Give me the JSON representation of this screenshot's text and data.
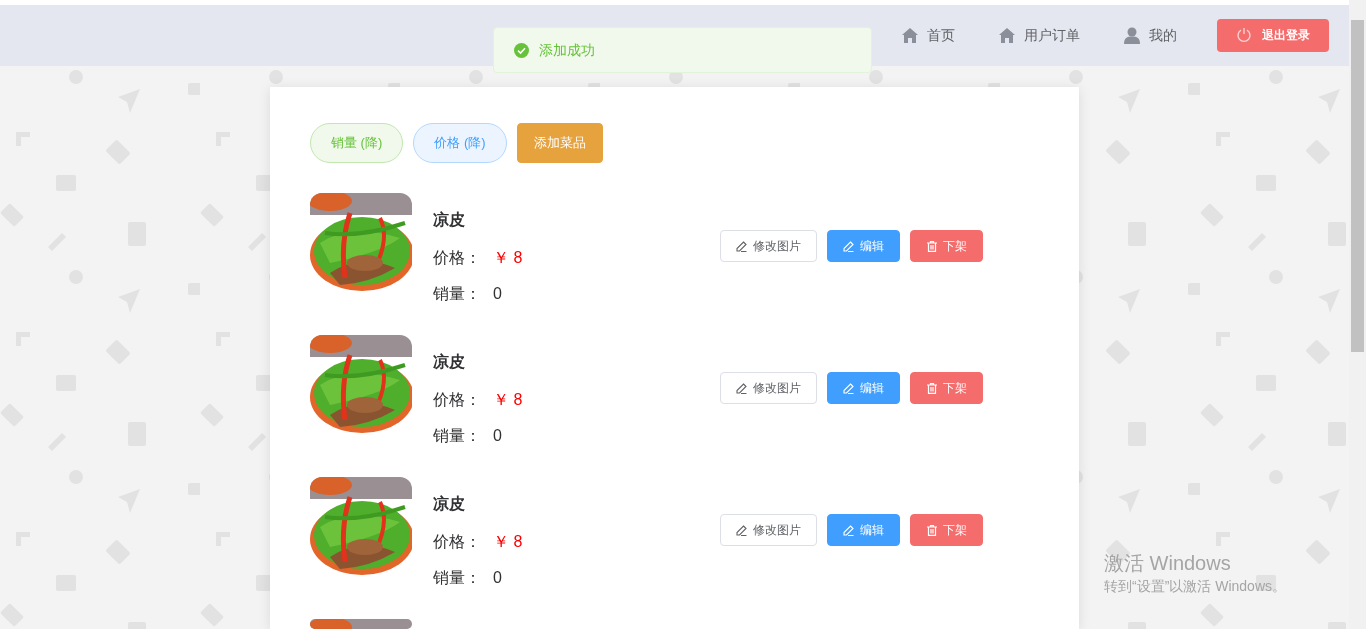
{
  "nav": {
    "items": [
      {
        "label": "首页",
        "kind": "home"
      },
      {
        "label": "用户订单",
        "kind": "home"
      },
      {
        "label": "我的",
        "kind": "user"
      }
    ],
    "logout": "退出登录"
  },
  "toast": {
    "kind": "success",
    "text": "添加成功"
  },
  "toolbar": [
    {
      "label": "销量 (降)",
      "kind": "success"
    },
    {
      "label": "价格 (降)",
      "kind": "primary"
    },
    {
      "label": "添加菜品",
      "kind": "warning"
    }
  ],
  "dishes": [
    {
      "name": "凉皮",
      "price_label": "价格：",
      "price": "￥ 8",
      "sales_label": "销量：",
      "sales": "0",
      "actions": [
        {
          "label": "修改图片",
          "kind": "default"
        },
        {
          "label": "编辑",
          "kind": "primary"
        },
        {
          "label": "下架",
          "kind": "danger"
        }
      ]
    },
    {
      "name": "凉皮",
      "price_label": "价格：",
      "price": "￥ 8",
      "sales_label": "销量：",
      "sales": "0",
      "actions": [
        {
          "label": "修改图片",
          "kind": "default"
        },
        {
          "label": "编辑",
          "kind": "primary"
        },
        {
          "label": "下架",
          "kind": "danger"
        }
      ]
    },
    {
      "name": "凉皮",
      "price_label": "价格：",
      "price": "￥ 8",
      "sales_label": "销量：",
      "sales": "0",
      "actions": [
        {
          "label": "修改图片",
          "kind": "default"
        },
        {
          "label": "编辑",
          "kind": "primary"
        },
        {
          "label": "下架",
          "kind": "danger"
        }
      ]
    }
  ],
  "os_notice": {
    "title": "激活 Windows",
    "text": "转到“设置”以激活 Windows。"
  }
}
